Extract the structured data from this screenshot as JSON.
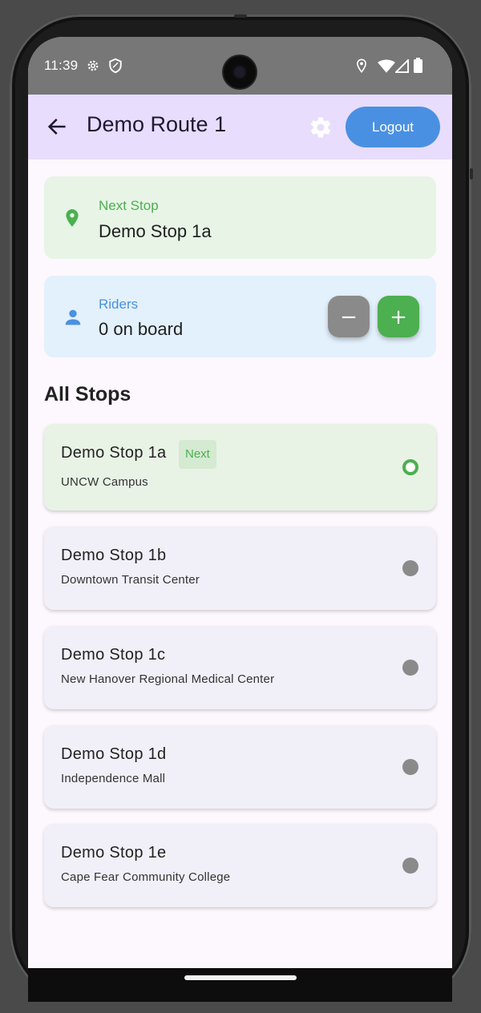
{
  "status_bar": {
    "time": "11:39",
    "icons": [
      "settings-gear-icon",
      "shield-icon",
      "location-icon",
      "wifi-icon",
      "signal-icon",
      "battery-icon"
    ]
  },
  "app_bar": {
    "title": "Demo Route 1",
    "logout_label": "Logout",
    "colors": {
      "background": "#e8ddfd",
      "logout": "#4a90e2"
    }
  },
  "next_stop": {
    "label": "Next Stop",
    "value": "Demo Stop 1a",
    "icon": "location-pin-icon",
    "colors": {
      "accent": "#4caf50",
      "background": "#e7f4e6"
    }
  },
  "riders": {
    "label": "Riders",
    "value": "0 on board",
    "icon": "person-icon",
    "decrement_label": "−",
    "increment_label": "+",
    "colors": {
      "accent": "#4a90e2",
      "background": "#e3f1fc",
      "decrement": "#8a8a8a",
      "increment": "#4caf50"
    }
  },
  "all_stops": {
    "title": "All Stops",
    "next_chip": "Next",
    "stops": [
      {
        "name": "Demo Stop 1a",
        "address": "UNCW Campus",
        "is_next": true
      },
      {
        "name": "Demo Stop 1b",
        "address": "Downtown Transit Center",
        "is_next": false
      },
      {
        "name": "Demo Stop 1c",
        "address": "New Hanover Regional Medical Center",
        "is_next": false
      },
      {
        "name": "Demo Stop 1d",
        "address": "Independence Mall",
        "is_next": false
      },
      {
        "name": "Demo Stop 1e",
        "address": "Cape Fear Community College",
        "is_next": false
      }
    ]
  }
}
